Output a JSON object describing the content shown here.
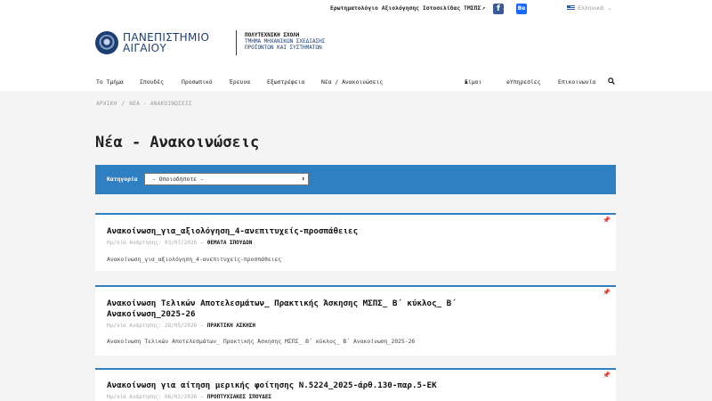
{
  "topstrip": {
    "survey_link": "Ερωτηματολόγιο Αξιολόγησης Ιστοσελίδας ΤΜΣΠΣ",
    "facebook_label": "f",
    "behance_label": "Be",
    "language": "Ελληνικά"
  },
  "brand": {
    "university_line1": "ΠΑΝΕΠΙΣΤΗΜΙΟ",
    "university_line2": "ΑΙΓΑΙΟΥ",
    "school": "ΠΟΛΥΤΕΧΝΙΚΗ ΣΧΟΛΗ",
    "dept_line1": "ΤΜΗΜΑ ΜΗΧΑΝΙΚΩΝ ΣΧΕΔΙΑΣΗΣ",
    "dept_line2": "ΠΡΟΪΟΝΤΩΝ ΚΑΙ ΣΥΣΤΗΜΑΤΩΝ"
  },
  "nav": {
    "items": [
      "Το Τμήμα",
      "Σπουδές",
      "Προσωπικό",
      "Έρευνα",
      "Εξωστρέφεια",
      "Νέα / Ανακοινώσεις"
    ],
    "right_items": [
      "Είμαι",
      "eΥπηρεσίες",
      "Επικοινωνία"
    ]
  },
  "breadcrumb": {
    "home": "ΑΡΧΙΚΗ",
    "separator": "/",
    "current": "ΝΕΑ - ΑΝΑΚΟΙΝΩΣΕΙΣ"
  },
  "page_title": "Νέα - Ανακοινώσεις",
  "filter": {
    "label": "Κατηγορία",
    "selected": "- Οποιοδήποτε -"
  },
  "meta_label": "Ημ/νία Ανάρτησης:",
  "announcements": [
    {
      "title": "Ανακοίνωση_για_αξιολόγηση_4-ανεπιτυχείς-προσπάθειες",
      "date": "03/07/2026",
      "category": "ΘΕΜΑΤΑ ΣΠΟΥΔΩΝ",
      "excerpt": "Ανακοίνωση_για_αξιολόγηση_4-ανεπιτυχείς-προσπάθειες"
    },
    {
      "title_line1": "Ανακοίνωση Τελικών Αποτελεσμάτων_ Πρακτικής Άσκησης ΜΣΠΣ_ Β΄ κύκλος_ Β΄",
      "title_line2": "Ανακοίνωση_2025-26",
      "date": "28/05/2026",
      "category": "ΠΡΑΚΤΙΚΗ ΑΣΚΗΣΗ",
      "excerpt": "Ανακοίνωση Τελικών Αποτελεσμάτων_ Πρακτικής Άσκησης ΜΣΠΣ_ Β΄ κύκλος_ Β΄ Ανακοίνωση_2025-26"
    },
    {
      "title": "Ανακοίνωση για αίτηση μερικής φοίτησης Ν.5224_2025-άρθ.130-παρ.5-ΕΚ",
      "date": "06/02/2026",
      "category": "ΠΡΟΠΤΥΧΙΑΚΕΣ ΣΠΟΥΔΕΣ"
    }
  ],
  "colors": {
    "accent": "#2f80c3",
    "brand": "#1c3f73",
    "background": "#f4f4f4"
  },
  "icons": {
    "pin": "pin-icon",
    "search": "search-icon",
    "user": "user-icon",
    "external": "external-link-icon"
  }
}
